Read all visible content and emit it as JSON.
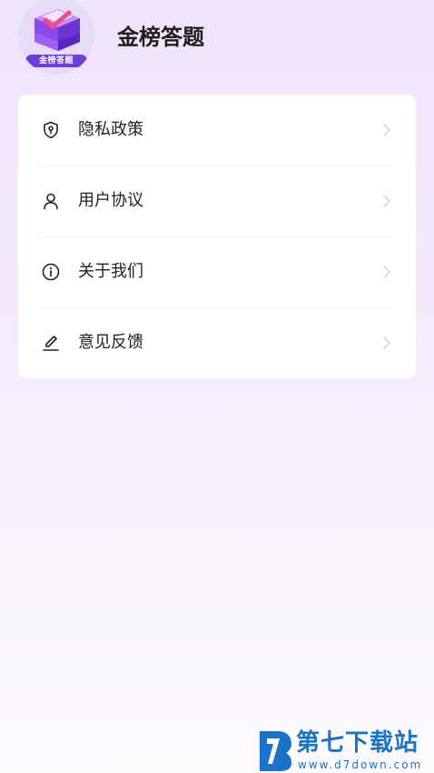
{
  "header": {
    "app_name": "金榜答题",
    "avatar_badge": "金榜答题"
  },
  "menu": {
    "items": [
      {
        "label": "隐私政策",
        "icon": "shield-icon"
      },
      {
        "label": "用户协议",
        "icon": "user-icon"
      },
      {
        "label": "关于我们",
        "icon": "info-icon"
      },
      {
        "label": "意见反馈",
        "icon": "pen-icon"
      }
    ]
  },
  "watermark": {
    "title": "第七下载站",
    "url": "www.d7down.com"
  },
  "colors": {
    "accent_purple": "#6b3fd9",
    "watermark_blue": "#1a73c9"
  }
}
